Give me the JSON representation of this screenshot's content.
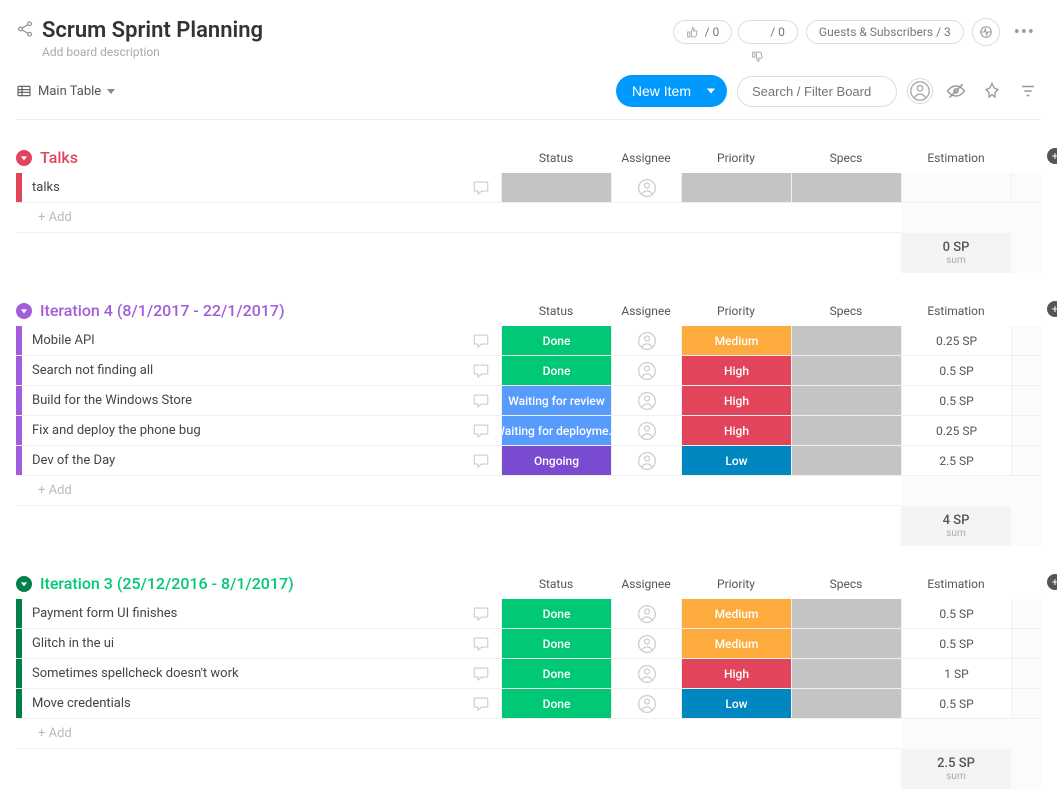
{
  "header": {
    "title": "Scrum Sprint Planning",
    "subtitle": "Add board description",
    "thumbs_up": "/ 0",
    "thumbs_down": "/ 0",
    "guests": "Guests & Subscribers / 3"
  },
  "toolbar": {
    "view": "Main Table",
    "new_item": "New Item",
    "search_placeholder": "Search / Filter Board"
  },
  "columns": {
    "status": "Status",
    "assignee": "Assignee",
    "priority": "Priority",
    "specs": "Specs",
    "estimation": "Estimation"
  },
  "common": {
    "add_row": "+ Add",
    "sum_label": "sum"
  },
  "groups": [
    {
      "id": "talks",
      "title": "Talks",
      "color": "red",
      "rows": [
        {
          "name": "talks",
          "status": "",
          "status_bg": "",
          "priority": "",
          "priority_bg": "",
          "est": "",
          "empty": true
        }
      ],
      "sum": "0 SP"
    },
    {
      "id": "iter4",
      "title": "Iteration 4 (8/1/2017 - 22/1/2017)",
      "color": "purple",
      "rows": [
        {
          "name": "Mobile API",
          "status": "Done",
          "status_bg": "done",
          "priority": "Medium",
          "priority_bg": "medium",
          "est": "0.25 SP"
        },
        {
          "name": "Search not finding all",
          "status": "Done",
          "status_bg": "done",
          "priority": "High",
          "priority_bg": "high",
          "est": "0.5 SP"
        },
        {
          "name": "Build for the Windows Store",
          "status": "Waiting for review",
          "status_bg": "blue",
          "priority": "High",
          "priority_bg": "high",
          "est": "0.5 SP"
        },
        {
          "name": "Fix and deploy the phone bug",
          "status": "Waiting for deployme...",
          "status_bg": "blue",
          "priority": "High",
          "priority_bg": "high",
          "est": "0.25 SP"
        },
        {
          "name": "Dev of the Day",
          "status": "Ongoing",
          "status_bg": "ongoing",
          "priority": "Low",
          "priority_bg": "low",
          "est": "2.5 SP"
        }
      ],
      "sum": "4 SP"
    },
    {
      "id": "iter3",
      "title": "Iteration 3 (25/12/2016 - 8/1/2017)",
      "color": "green",
      "rows": [
        {
          "name": "Payment form UI finishes",
          "status": "Done",
          "status_bg": "done",
          "priority": "Medium",
          "priority_bg": "medium",
          "est": "0.5 SP"
        },
        {
          "name": "Glitch in the ui",
          "status": "Done",
          "status_bg": "done",
          "priority": "Medium",
          "priority_bg": "medium",
          "est": "0.5 SP"
        },
        {
          "name": "Sometimes spellcheck doesn't work",
          "status": "Done",
          "status_bg": "done",
          "priority": "High",
          "priority_bg": "high",
          "est": "1 SP"
        },
        {
          "name": "Move credentials",
          "status": "Done",
          "status_bg": "done",
          "priority": "Low",
          "priority_bg": "low",
          "est": "0.5 SP"
        }
      ],
      "sum": "2.5 SP"
    }
  ]
}
